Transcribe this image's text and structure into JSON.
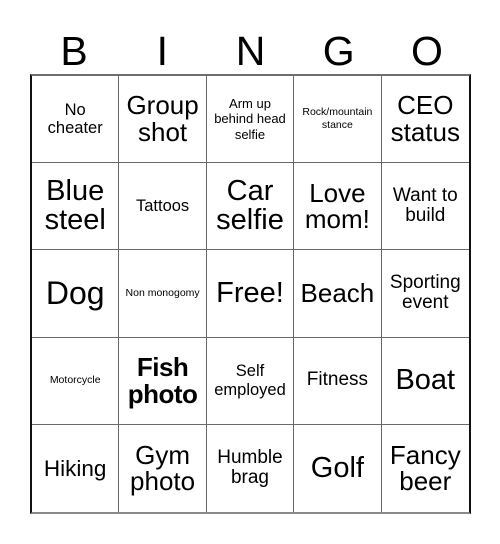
{
  "card": {
    "title": "BINGO",
    "header_letters": [
      "B",
      "I",
      "N",
      "G",
      "O"
    ],
    "free_space_label": "Free!",
    "grid_size": "5x5",
    "colors": {
      "background": "#ffffff",
      "text": "#000000",
      "border": "#6a6a6a",
      "outer_border": "#111111"
    },
    "rows": [
      [
        {
          "text": "No cheater",
          "size": "md",
          "bold": false
        },
        {
          "text": "Group shot",
          "size": "2xl",
          "bold": false
        },
        {
          "text": "Arm up behind head selfie",
          "size": "sm",
          "bold": false
        },
        {
          "text": "Rock/mountain stance",
          "size": "xs",
          "bold": false
        },
        {
          "text": "CEO status",
          "size": "2xl",
          "bold": false
        }
      ],
      [
        {
          "text": "Blue steel",
          "size": "3xl",
          "bold": false
        },
        {
          "text": "Tattoos",
          "size": "md",
          "bold": false
        },
        {
          "text": "Car selfie",
          "size": "3xl",
          "bold": false
        },
        {
          "text": "Love mom!",
          "size": "2xl",
          "bold": false
        },
        {
          "text": "Want to build",
          "size": "lg",
          "bold": false
        }
      ],
      [
        {
          "text": "Dog",
          "size": "4xl",
          "bold": false
        },
        {
          "text": "Non monogomy",
          "size": "xs",
          "bold": false
        },
        {
          "text": "Free!",
          "size": "3xl",
          "bold": false
        },
        {
          "text": "Beach",
          "size": "2xl",
          "bold": false
        },
        {
          "text": "Sporting event",
          "size": "lg",
          "bold": false
        }
      ],
      [
        {
          "text": "Motorcycle",
          "size": "xs",
          "bold": false
        },
        {
          "text": "Fish photo",
          "size": "2xl",
          "bold": true
        },
        {
          "text": "Self employed",
          "size": "md",
          "bold": false
        },
        {
          "text": "Fitness",
          "size": "lg",
          "bold": false
        },
        {
          "text": "Boat",
          "size": "3xl",
          "bold": false
        }
      ],
      [
        {
          "text": "Hiking",
          "size": "xl",
          "bold": false
        },
        {
          "text": "Gym photo",
          "size": "2xl",
          "bold": false
        },
        {
          "text": "Humble brag",
          "size": "lg",
          "bold": false
        },
        {
          "text": "Golf",
          "size": "3xl",
          "bold": false
        },
        {
          "text": "Fancy beer",
          "size": "2xl",
          "bold": false
        }
      ]
    ]
  }
}
